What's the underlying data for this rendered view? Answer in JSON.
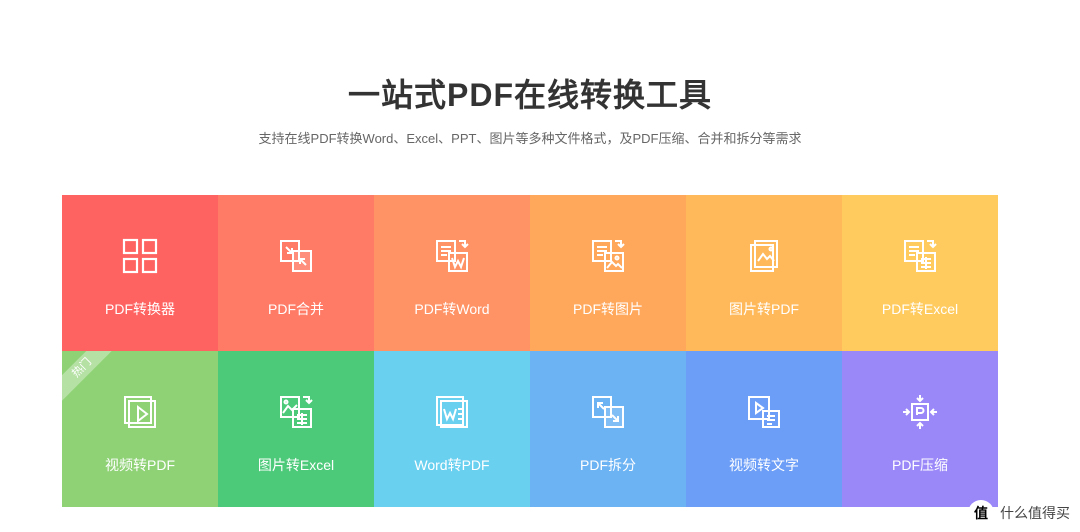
{
  "header": {
    "title": "一站式PDF在线转换工具",
    "subtitle": "支持在线PDF转换Word、Excel、PPT、图片等多种文件格式，及PDF压缩、合并和拆分等需求"
  },
  "tiles": [
    {
      "label": "PDF转换器",
      "icon": "grid-icon",
      "color": "#ff6361"
    },
    {
      "label": "PDF合并",
      "icon": "merge-icon",
      "color": "#ff7b66"
    },
    {
      "label": "PDF转Word",
      "icon": "pdf-to-word-icon",
      "color": "#ff9366"
    },
    {
      "label": "PDF转图片",
      "icon": "pdf-to-image-icon",
      "color": "#ffa85c"
    },
    {
      "label": "图片转PDF",
      "icon": "image-to-pdf-icon",
      "color": "#ffb95a"
    },
    {
      "label": "PDF转Excel",
      "icon": "pdf-to-excel-icon",
      "color": "#ffcb5e"
    },
    {
      "label": "视频转PDF",
      "icon": "video-to-pdf-icon",
      "color": "#8fd276",
      "badge": "热门"
    },
    {
      "label": "图片转Excel",
      "icon": "image-to-excel-icon",
      "color": "#4cca7a"
    },
    {
      "label": "Word转PDF",
      "icon": "word-to-pdf-icon",
      "color": "#6ad0f0"
    },
    {
      "label": "PDF拆分",
      "icon": "split-icon",
      "color": "#6cb3f4"
    },
    {
      "label": "视频转文字",
      "icon": "video-to-text-icon",
      "color": "#6c9ef7"
    },
    {
      "label": "PDF压缩",
      "icon": "compress-icon",
      "color": "#9a87f8"
    }
  ],
  "watermark": {
    "badge": "值",
    "text": "什么值得买"
  }
}
